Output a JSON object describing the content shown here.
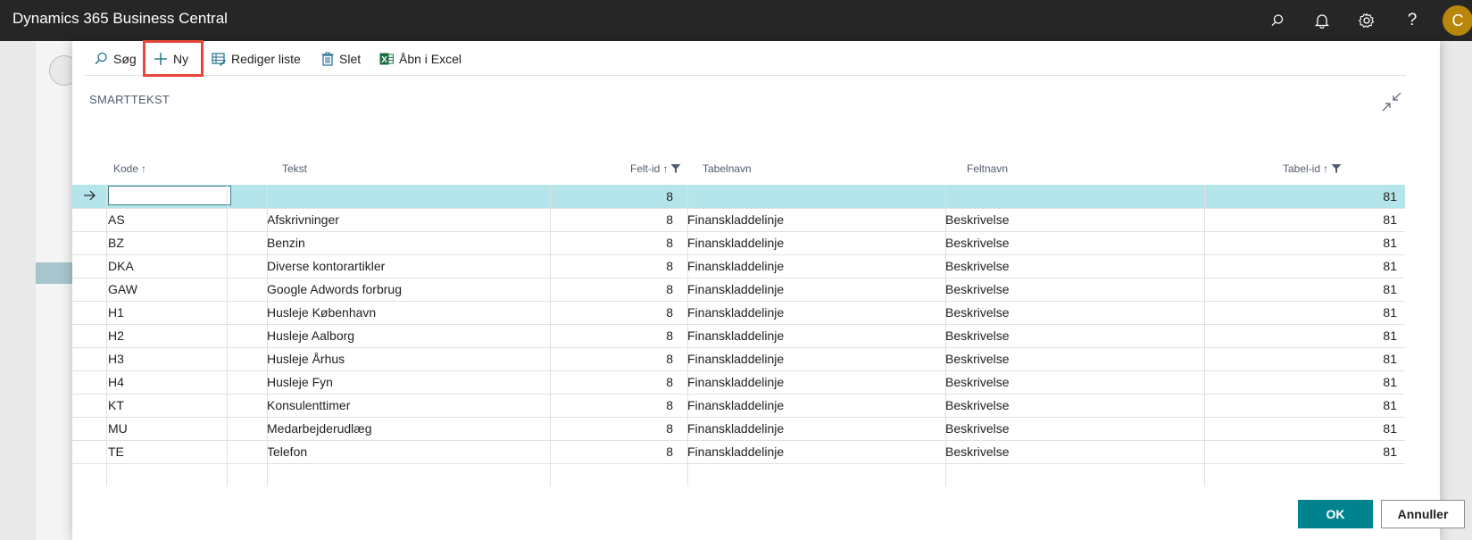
{
  "app": {
    "title": "Dynamics 365 Business Central",
    "avatar_initial": "C"
  },
  "actions": {
    "search": "Søg",
    "new": "Ny",
    "edit_list": "Rediger liste",
    "delete": "Slet",
    "open_excel": "Åbn i Excel"
  },
  "page": {
    "title": "SMARTTEKST"
  },
  "columns": {
    "kode": "Kode",
    "tekst": "Tekst",
    "felt_id": "Felt-id",
    "tabelnavn": "Tabelnavn",
    "feltnavn": "Feltnavn",
    "tabel_id": "Tabel-id"
  },
  "new_row": {
    "kode": "",
    "felt_id": "8",
    "tabel_id": "81"
  },
  "rows": [
    {
      "kode": "AS",
      "tekst": "Afskrivninger",
      "felt_id": "8",
      "tabelnavn": "Finanskladdelinje",
      "feltnavn": "Beskrivelse",
      "tabel_id": "81"
    },
    {
      "kode": "BZ",
      "tekst": "Benzin",
      "felt_id": "8",
      "tabelnavn": "Finanskladdelinje",
      "feltnavn": "Beskrivelse",
      "tabel_id": "81"
    },
    {
      "kode": "DKA",
      "tekst": "Diverse kontorartikler",
      "felt_id": "8",
      "tabelnavn": "Finanskladdelinje",
      "feltnavn": "Beskrivelse",
      "tabel_id": "81"
    },
    {
      "kode": "GAW",
      "tekst": "Google Adwords forbrug",
      "felt_id": "8",
      "tabelnavn": "Finanskladdelinje",
      "feltnavn": "Beskrivelse",
      "tabel_id": "81"
    },
    {
      "kode": "H1",
      "tekst": "Husleje København",
      "felt_id": "8",
      "tabelnavn": "Finanskladdelinje",
      "feltnavn": "Beskrivelse",
      "tabel_id": "81"
    },
    {
      "kode": "H2",
      "tekst": "Husleje Aalborg",
      "felt_id": "8",
      "tabelnavn": "Finanskladdelinje",
      "feltnavn": "Beskrivelse",
      "tabel_id": "81"
    },
    {
      "kode": "H3",
      "tekst": "Husleje Århus",
      "felt_id": "8",
      "tabelnavn": "Finanskladdelinje",
      "feltnavn": "Beskrivelse",
      "tabel_id": "81"
    },
    {
      "kode": "H4",
      "tekst": "Husleje Fyn",
      "felt_id": "8",
      "tabelnavn": "Finanskladdelinje",
      "feltnavn": "Beskrivelse",
      "tabel_id": "81"
    },
    {
      "kode": "KT",
      "tekst": "Konsulenttimer",
      "felt_id": "8",
      "tabelnavn": "Finanskladdelinje",
      "feltnavn": "Beskrivelse",
      "tabel_id": "81"
    },
    {
      "kode": "MU",
      "tekst": "Medarbejderudlæg",
      "felt_id": "8",
      "tabelnavn": "Finanskladdelinje",
      "feltnavn": "Beskrivelse",
      "tabel_id": "81"
    },
    {
      "kode": "TE",
      "tekst": "Telefon",
      "felt_id": "8",
      "tabelnavn": "Finanskladdelinje",
      "feltnavn": "Beskrivelse",
      "tabel_id": "81"
    }
  ],
  "buttons": {
    "ok": "OK",
    "cancel": "Annuller"
  },
  "colors": {
    "topbar": "#262626",
    "accent": "#00838f",
    "selected_row": "#b4e5ea",
    "highlight": "#e8463a",
    "avatar": "#b8860b"
  }
}
